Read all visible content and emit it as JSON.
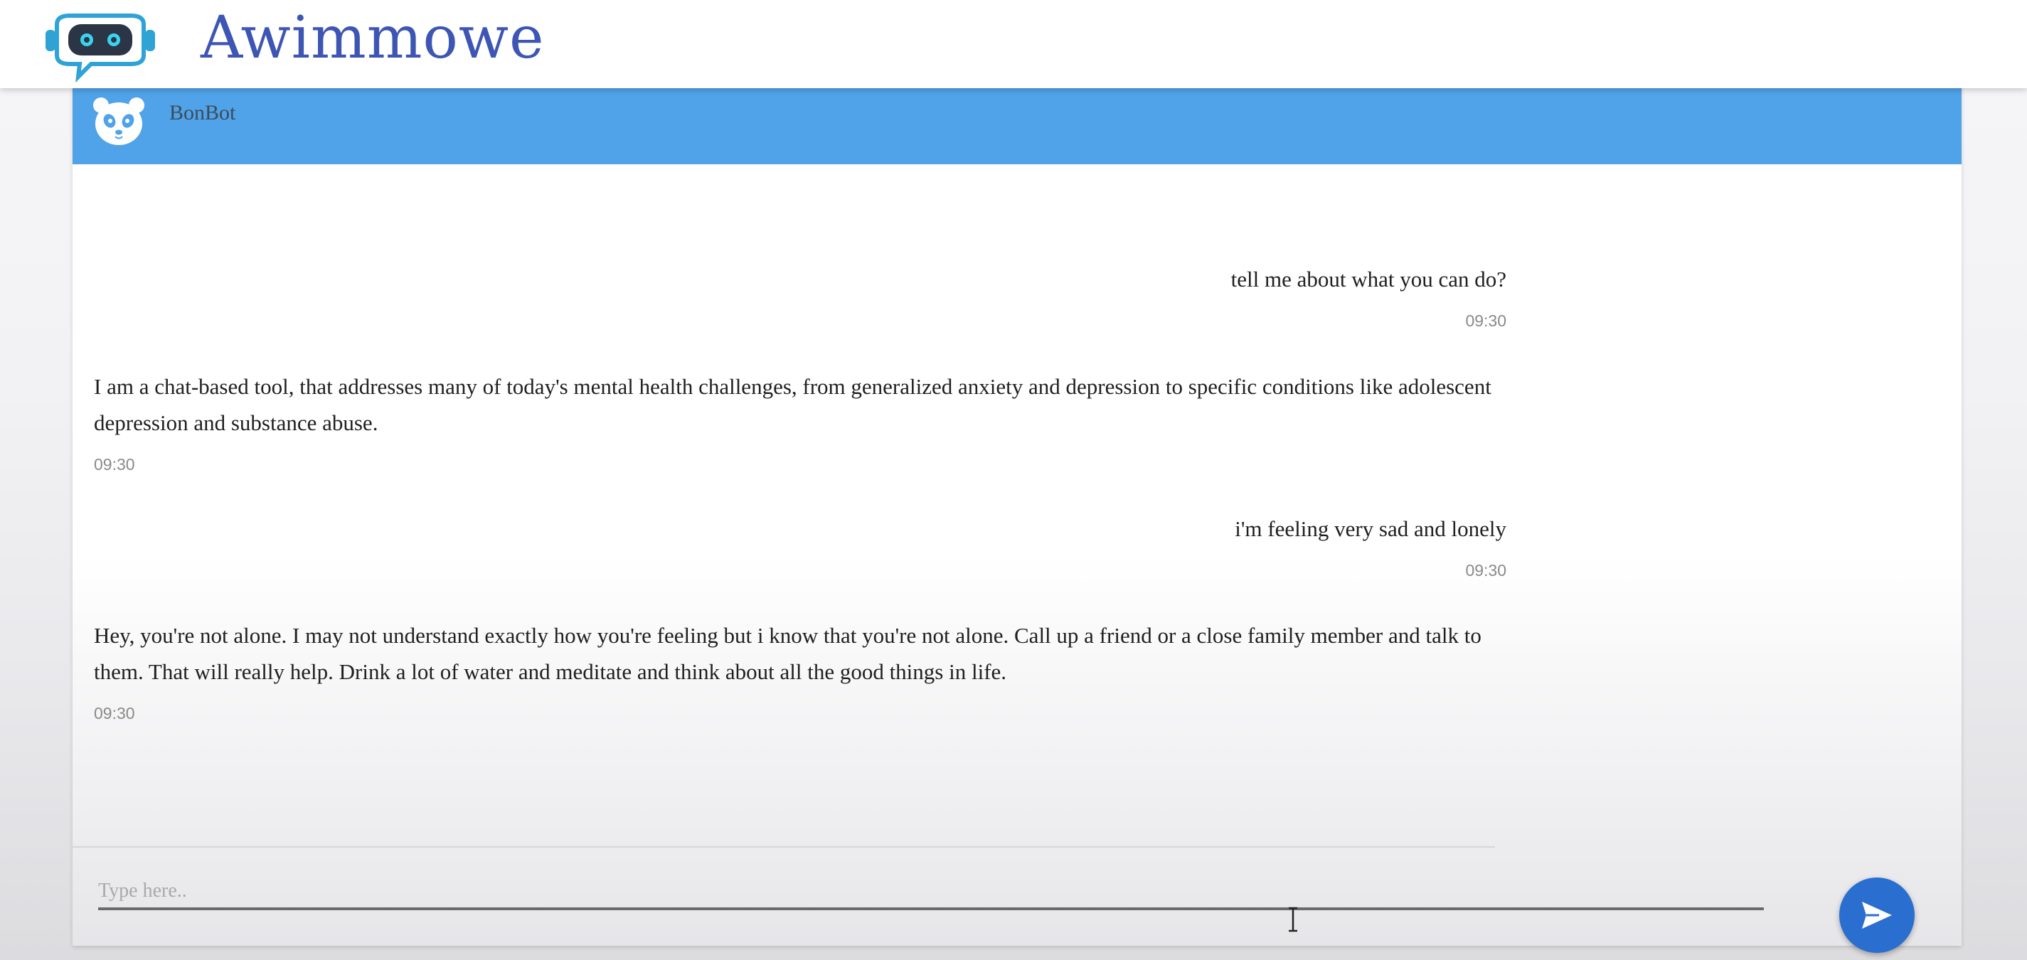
{
  "app": {
    "brand_title": "Awimmowe",
    "logo_icon": "robot-chat-icon"
  },
  "chat": {
    "bot_name": "BonBot",
    "bot_avatar_icon": "panda-avatar-icon",
    "header_color": "#50a3e8",
    "messages": [
      {
        "sender": "user",
        "text": "tell me about what you can do?",
        "time": "09:30"
      },
      {
        "sender": "bot",
        "text": "I am a chat-based tool, that addresses many of today's mental health challenges, from generalized anxiety and depression to specific conditions like adolescent depression and substance abuse.",
        "time": "09:30"
      },
      {
        "sender": "user",
        "text": "i'm feeling very sad and lonely",
        "time": "09:30"
      },
      {
        "sender": "bot",
        "text": "Hey, you're not alone. I may not understand exactly how you're feeling but i know that you're not alone. Call up a friend or a close family member and talk to them. That will really help. Drink a lot of water and meditate and think about all the good things in life.",
        "time": "09:30"
      }
    ]
  },
  "composer": {
    "placeholder": "Type here..",
    "value": "",
    "send_icon": "send-icon",
    "send_color": "#2a6fd0"
  }
}
